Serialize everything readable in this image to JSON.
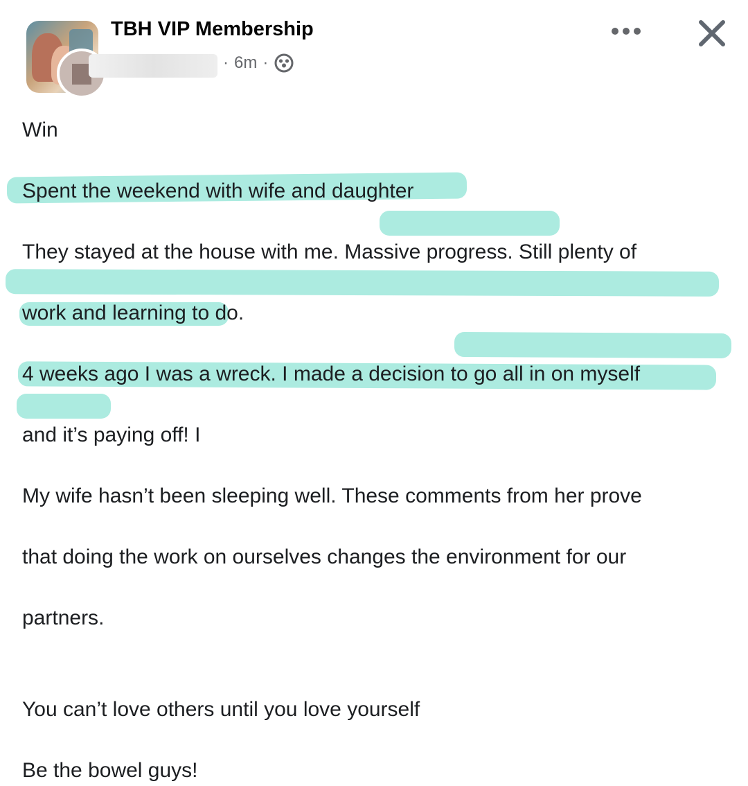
{
  "post": {
    "group_name": "TBH VIP Membership",
    "meta": {
      "separator": "·",
      "time": "6m"
    },
    "privacy_icon": "group-members-icon",
    "more_icon": "more-horizontal-icon",
    "close_icon": "close-icon"
  },
  "content": {
    "title": "Win",
    "l1": "Spent the weekend with wife and daughter",
    "l2a": "They stayed at the house with me. ",
    "l2b": "Massive progress",
    "l2c": ". Still plenty of",
    "l3": "work and learning to do.",
    "l4": "4 weeks ago I was a wreck. I made a decision to go all in on myself",
    "l5": "and it’s paying off! I",
    "l6a": "My wife hasn’t been sleeping well. These ",
    "l6b": "comments from her prove",
    "l7": "that doing the work on ourselves changes the environment for our",
    "l8a": "partners",
    "l8b": ".",
    "l9": "You can’t love others until you love yourself",
    "l10": "Be the bowel guys!"
  },
  "colors": {
    "highlight": "#8ce3d4",
    "text": "#1c1e21",
    "meta": "#65676b"
  }
}
